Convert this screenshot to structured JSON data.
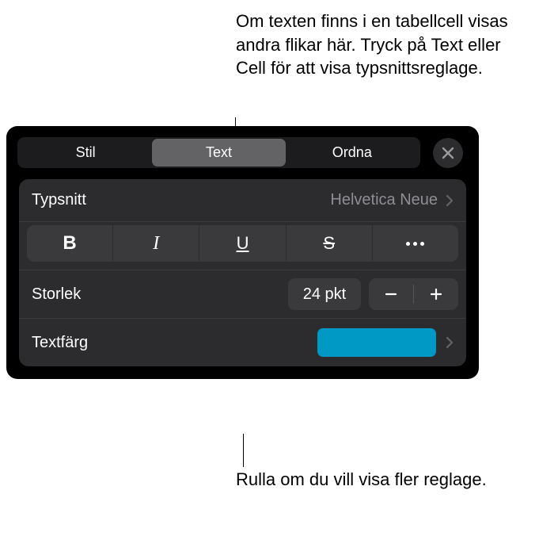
{
  "callouts": {
    "top": "Om texten finns i en tabellcell visas andra flikar här. Tryck på Text eller Cell för att visa typsnittsreglage.",
    "bottom": "Rulla om du vill visa fler reglage."
  },
  "tabs": {
    "stil": "Stil",
    "text": "Text",
    "ordna": "Ordna"
  },
  "font": {
    "label": "Typsnitt",
    "value": "Helvetica Neue"
  },
  "styleButtons": {
    "bold": "B",
    "italic": "I",
    "underline": "U",
    "strike": "S"
  },
  "size": {
    "label": "Storlek",
    "value": "24 pkt"
  },
  "textColor": {
    "label": "Textfärg",
    "swatch": "#0099c6"
  }
}
